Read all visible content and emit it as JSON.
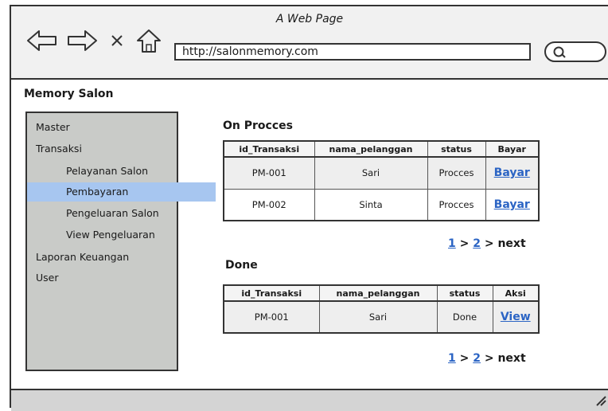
{
  "window": {
    "title": "A Web Page"
  },
  "browser": {
    "url": "http://salonmemory.com"
  },
  "app": {
    "title": "Memory Salon"
  },
  "sidebar": {
    "items": [
      {
        "label": "Master"
      },
      {
        "label": "Transaksi"
      },
      {
        "label": "Pelayanan Salon"
      },
      {
        "label": "Pembayaran"
      },
      {
        "label": "Pengeluaran Salon"
      },
      {
        "label": "View Pengeluaran"
      },
      {
        "label": "Laporan Keuangan"
      },
      {
        "label": "User"
      }
    ]
  },
  "on_process": {
    "title": "On Procces",
    "columns": [
      "id_Transaksi",
      "nama_pelanggan",
      "status",
      "Bayar"
    ],
    "rows": [
      {
        "id": "PM-001",
        "name": "Sari",
        "status": "Procces",
        "action": "Bayar"
      },
      {
        "id": "PM-002",
        "name": "Sinta",
        "status": "Procces",
        "action": "Bayar"
      }
    ],
    "pager": {
      "page1": "1",
      "sep": ">",
      "page2": "2",
      "next": "next"
    }
  },
  "done": {
    "title": "Done",
    "columns": [
      "id_Transaksi",
      "nama_pelanggan",
      "status",
      "Aksi"
    ],
    "rows": [
      {
        "id": "PM-001",
        "name": "Sari",
        "status": "Done",
        "action": "View"
      }
    ],
    "pager": {
      "page1": "1",
      "sep": ">",
      "page2": "2",
      "next": "next"
    }
  },
  "colors": {
    "sidebar_bg": "#c9cbc8",
    "active_item": "#a7c6f0",
    "link": "#2b64c4"
  }
}
